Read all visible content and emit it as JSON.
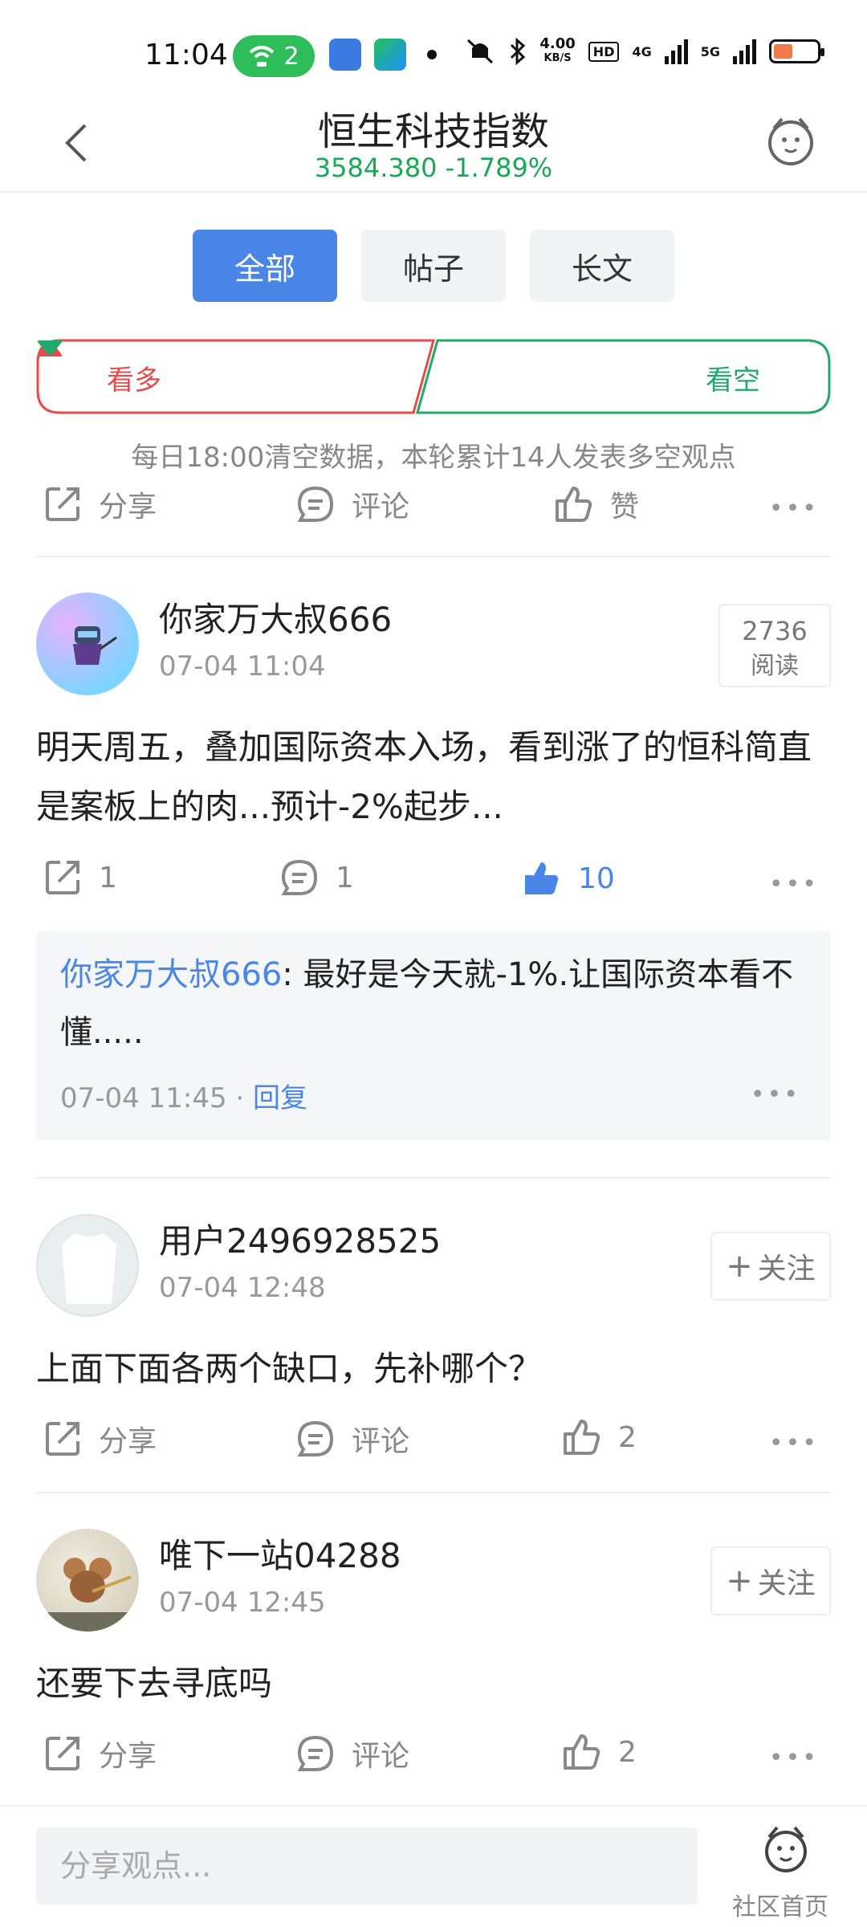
{
  "status_bar": {
    "time": "11:04",
    "hotspot_count": "2",
    "speed_value": "4.00",
    "speed_unit": "KB/S",
    "hd_badge": "HD",
    "network_4g": "4G",
    "network_5g": "5G",
    "battery_level": 0.45
  },
  "header": {
    "title": "恒生科技指数",
    "quote": "3584.380  -1.789%"
  },
  "tabs": [
    {
      "label": "全部",
      "active": true
    },
    {
      "label": "帖子",
      "active": false
    },
    {
      "label": "长文",
      "active": false
    }
  ],
  "vote": {
    "bull_label": "看多",
    "bear_label": "看空",
    "note": "每日18:00清空数据，本轮累计14人发表多空观点"
  },
  "top_actions": {
    "share": "分享",
    "comment": "评论",
    "like": "赞"
  },
  "posts": [
    {
      "username": "你家万大叔666",
      "time": "07-04 11:04",
      "read_count": "2736",
      "read_label": "阅读",
      "content": "明天周五，叠加国际资本入场，看到涨了的恒科简直是案板上的肉...预计-2%起步...",
      "share": "1",
      "comment": "1",
      "like": "10",
      "reply": {
        "user": "你家万大叔666",
        "text": ": 最好是今天就-1%.让国际资本看不懂.....",
        "time": "07-04 11:45 · ",
        "reply_link": "回复"
      }
    },
    {
      "username": "用户2496928525",
      "time": "07-04 12:48",
      "follow_label": "关注",
      "content": "上面下面各两个缺口，先补哪个？",
      "share": "分享",
      "comment": "评论",
      "like": "2"
    },
    {
      "username": "唯下一站04288",
      "time": "07-04 12:45",
      "follow_label": "关注",
      "content": "还要下去寻底吗",
      "share": "分享",
      "comment": "评论",
      "like": "2"
    }
  ],
  "bottom": {
    "input_placeholder": "分享观点...",
    "home_label": "社区首页"
  },
  "colors": {
    "accent": "#4a86e8",
    "bull": "#e54b4b",
    "bear": "#23a86b",
    "quote_green": "#1aa857"
  }
}
